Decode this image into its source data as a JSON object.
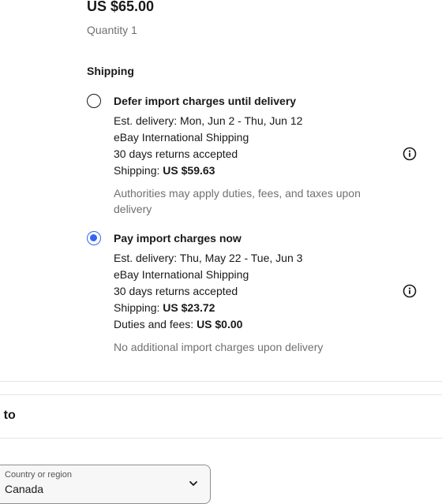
{
  "item": {
    "price": "US $65.00",
    "quantity": "Quantity 1"
  },
  "shipping": {
    "heading": "Shipping",
    "options": [
      {
        "title": "Defer import charges until delivery",
        "selected": false,
        "est_delivery": "Est. delivery: Mon, Jun 2 - Thu, Jun 12",
        "carrier": "eBay International Shipping",
        "returns": "30 days returns accepted",
        "shipping_label": "Shipping:",
        "shipping_cost": "US $59.63",
        "note": "Authorities may apply duties, fees, and taxes upon delivery",
        "info_icon": "info-circle-icon"
      },
      {
        "title": "Pay import charges now",
        "selected": true,
        "est_delivery": "Est. delivery: Thu, May 22 - Tue, Jun 3",
        "carrier": "eBay International Shipping",
        "returns": "30 days returns accepted",
        "shipping_label": "Shipping:",
        "shipping_cost": "US $23.72",
        "duties_label": "Duties and fees:",
        "duties_cost": "US $0.00",
        "note": "No additional import charges upon delivery",
        "info_icon": "info-circle-icon"
      }
    ]
  },
  "ship_to": {
    "heading": "ip to",
    "country_caption": "Country or region",
    "country_value": "Canada",
    "chevron_icon": "chevron-down-icon"
  },
  "colors": {
    "accent": "#3665f3",
    "text": "#191919",
    "muted": "#707070"
  }
}
